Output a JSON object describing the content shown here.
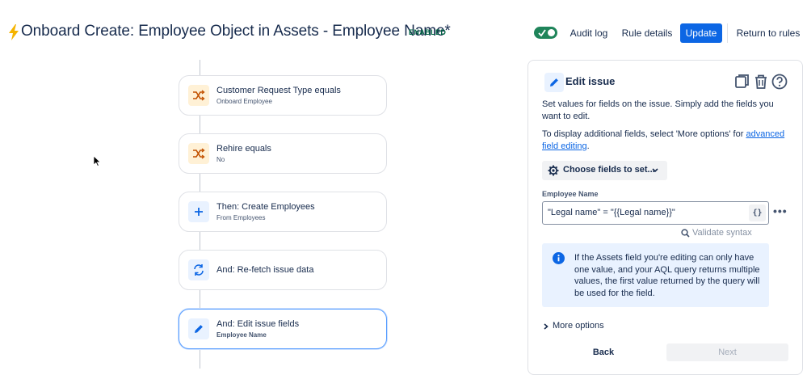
{
  "header": {
    "title": "Onboard Create: Employee Object in Assets - Employee Name*",
    "status_badge": "ENABLED",
    "toggle_enabled": true,
    "audit_log": "Audit log",
    "rule_details": "Rule details",
    "update": "Update",
    "return_to_rules": "Return to rules",
    "accent_color": "#0c66e4"
  },
  "flow": {
    "items": [
      {
        "title": "Customer Request Type equals",
        "subtitle": "Onboard Employee",
        "icon": "condition-shuffle-icon"
      },
      {
        "title": "Rehire equals",
        "subtitle": "No",
        "icon": "condition-shuffle-icon"
      },
      {
        "title": "Then: Create Employees",
        "subtitle": "From Employees",
        "icon": "plus-icon"
      },
      {
        "title": "And: Re-fetch issue data",
        "subtitle": "",
        "icon": "refresh-icon"
      },
      {
        "title": "And: Edit issue fields",
        "subtitle": "Employee Name",
        "icon": "pencil-icon",
        "selected": true
      }
    ]
  },
  "panel": {
    "title": "Edit issue",
    "description": "Set values for fields on the issue. Simply add the fields you want to edit.",
    "advanced_text": "To display additional fields, select 'More options' for ",
    "advanced_link": "advanced field editing",
    "advanced_suffix": ".",
    "choose_fields": "Choose fields to set...",
    "field_label": "Employee Name",
    "field_value": "\"Legal name\" = \"{{Legal name}}\"",
    "braces": "{}",
    "validate": "Validate syntax",
    "info": "If the Assets field you're editing can only have one value, and your AQL query returns multiple values, the first value returned by the query will be used for the field.",
    "more_options": "More options",
    "back": "Back",
    "next": "Next"
  }
}
